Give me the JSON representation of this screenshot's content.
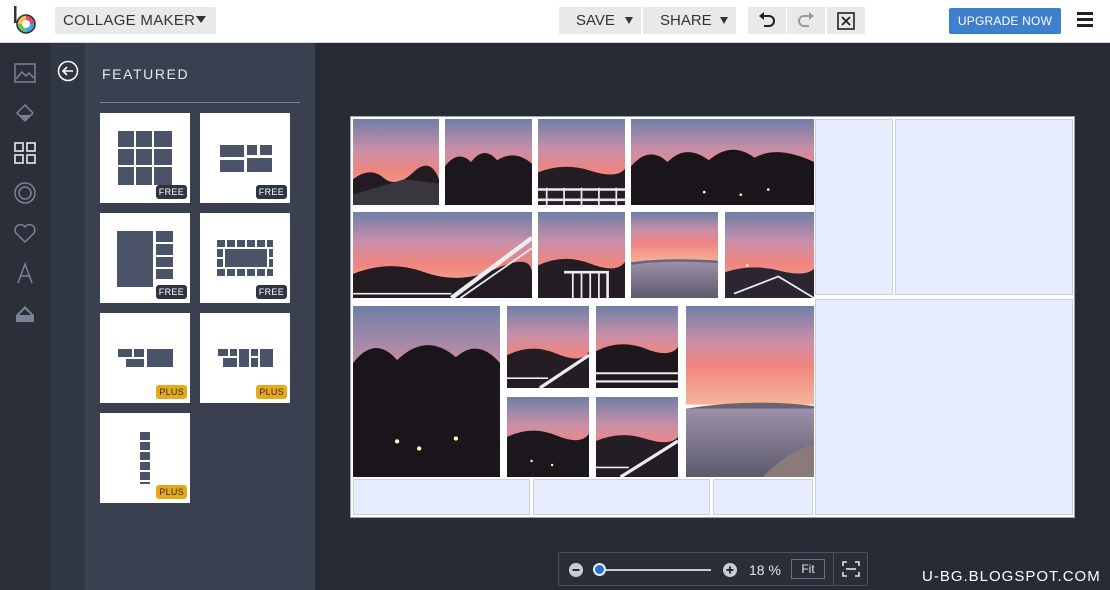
{
  "header": {
    "app_menu_label": "COLLAGE MAKER",
    "save_label": "SAVE",
    "share_label": "SHARE",
    "upgrade_label": "UPGRADE NOW"
  },
  "sidebar": {
    "icons": [
      "image-icon",
      "paint-bucket-icon",
      "collage-grid-icon",
      "sticker-icon",
      "heart-icon",
      "text-icon",
      "eraser-icon"
    ],
    "active": "collage-grid-icon"
  },
  "panel": {
    "title": "FEATURED",
    "templates": [
      {
        "layout": "3x3 grid",
        "badge": "FREE"
      },
      {
        "layout": "mixed tiles",
        "badge": "FREE"
      },
      {
        "layout": "large left column",
        "badge": "FREE"
      },
      {
        "layout": "framed border",
        "badge": "FREE"
      },
      {
        "layout": "offset row",
        "badge": "PLUS"
      },
      {
        "layout": "scattered blocks",
        "badge": "PLUS"
      },
      {
        "layout": "vertical strip",
        "badge": "PLUS"
      }
    ]
  },
  "zoom": {
    "value": "18 %",
    "level": 0.18,
    "fit_label": "Fit"
  },
  "watermark": "U-BG.BLOGSPOT.COM",
  "colors": {
    "accent": "#3e7fce",
    "plus_badge": "#e4a91c",
    "free_badge": "#2f3441",
    "slot": "#e8edfd"
  }
}
